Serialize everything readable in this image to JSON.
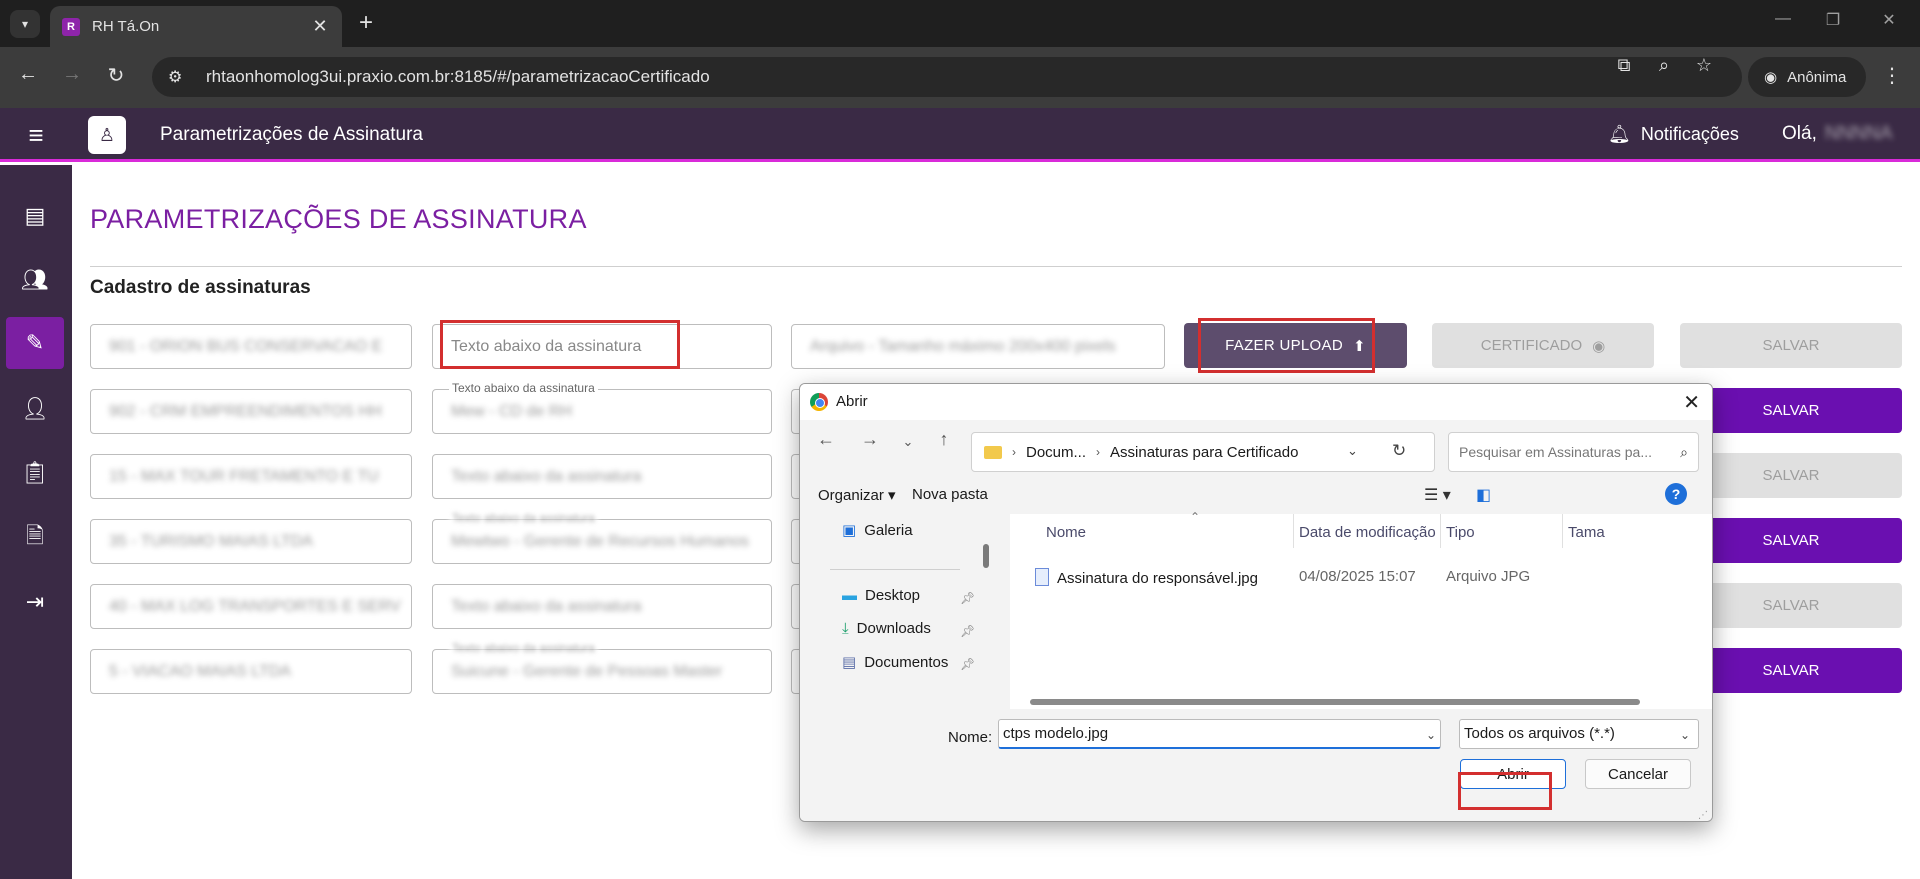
{
  "browser": {
    "tab_title": "RH Tá.On",
    "url": "rhtaonhomolog3ui.praxio.com.br:8185/#/parametrizacaoCertificado",
    "incognito_label": "Anônima"
  },
  "app": {
    "header_title": "Parametrizações de Assinatura",
    "notifications_label": "Notificações",
    "greeting": "Olá,",
    "user_name": "NNNNA"
  },
  "page": {
    "title": "PARAMETRIZAÇÕES DE ASSINATURA",
    "section": "Cadastro de assinaturas",
    "field_label": "Texto abaixo da assinatura",
    "upload_label": "FAZER UPLOAD",
    "certificate_label": "CERTIFICADO",
    "save_label": "SALVAR",
    "file_placeholder": "Arquivo - Tamanho máximo 200x400 pixels",
    "rows": [
      {
        "company": "901 - ORION BUS CONSERVACAO E",
        "text": "",
        "save": "off"
      },
      {
        "company": "902 - CRM EMPREENDIMENTOS HH",
        "text": "Mew - CD de RH",
        "save": "on"
      },
      {
        "company": "15 - MAX TOUR FRETAMENTO E TU",
        "text": "",
        "save": "off"
      },
      {
        "company": "35 - TURISMO MAIAS LTDA",
        "text": "Mewtwo - Gerente de Recursos Humanos",
        "save": "on"
      },
      {
        "company": "40 - MAX LOG TRANSPORTES E SERV",
        "text": "",
        "save": "off"
      },
      {
        "company": "5 - VIACAO MAIAS LTDA",
        "text": "Suicune - Gerente de Pessoas Master",
        "save": "on"
      }
    ]
  },
  "dialog": {
    "title": "Abrir",
    "path": [
      "Docum...",
      "Assinaturas para Certificado"
    ],
    "search_placeholder": "Pesquisar em Assinaturas pa...",
    "organize_label": "Organizar",
    "new_folder_label": "Nova pasta",
    "nav_items": [
      "Galeria",
      "Desktop",
      "Downloads",
      "Documentos"
    ],
    "columns": [
      "Nome",
      "Data de modificação",
      "Tipo",
      "Tama"
    ],
    "files": [
      {
        "name": "Assinatura do responsável.jpg",
        "modified": "04/08/2025 15:07",
        "type": "Arquivo JPG"
      }
    ],
    "name_label": "Nome:",
    "name_value": "ctps modelo.jpg",
    "file_type": "Todos os arquivos (*.*)",
    "open_label": "Abrir",
    "cancel_label": "Cancelar"
  },
  "colors": {
    "brand_purple": "#7b1fa2",
    "header_bg": "#3a2a45",
    "accent_line": "#d92ad9",
    "save_active": "#6a0fb0",
    "highlight": "#d32f2f"
  }
}
